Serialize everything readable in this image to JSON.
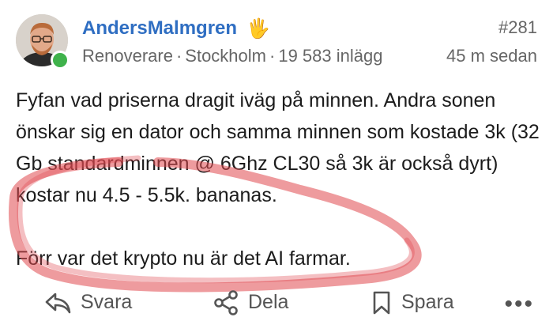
{
  "post": {
    "username": "AndersMalmgren",
    "username_emoji": "🖐",
    "post_number": "#281",
    "role": "Renoverare",
    "location": "Stockholm",
    "post_count": "19 583 inlägg",
    "time_ago": "45 m sedan",
    "body": {
      "paragraph_1": "Fyfan vad priserna dragit iväg på minnen. Andra sonen önskar sig en dator och samma minnen som kostade 3k (32 Gb standardminnen @ 6Ghz CL30 så 3k är också dyrt) kostar nu 4.5 - 5.5k. bananas.",
      "paragraph_2": "Förr var det krypto nu är det AI farmar."
    },
    "scribble_color": "#e0484f",
    "online_color": "#3fb24b",
    "link_color": "#2f6ec2"
  },
  "actions": {
    "reply": {
      "label": "Svara",
      "icon": "reply-icon"
    },
    "share": {
      "label": "Dela",
      "icon": "share-icon"
    },
    "save": {
      "label": "Spara",
      "icon": "bookmark-icon"
    },
    "more": {
      "label": "•••",
      "icon": "more-icon"
    }
  },
  "separator": "·"
}
